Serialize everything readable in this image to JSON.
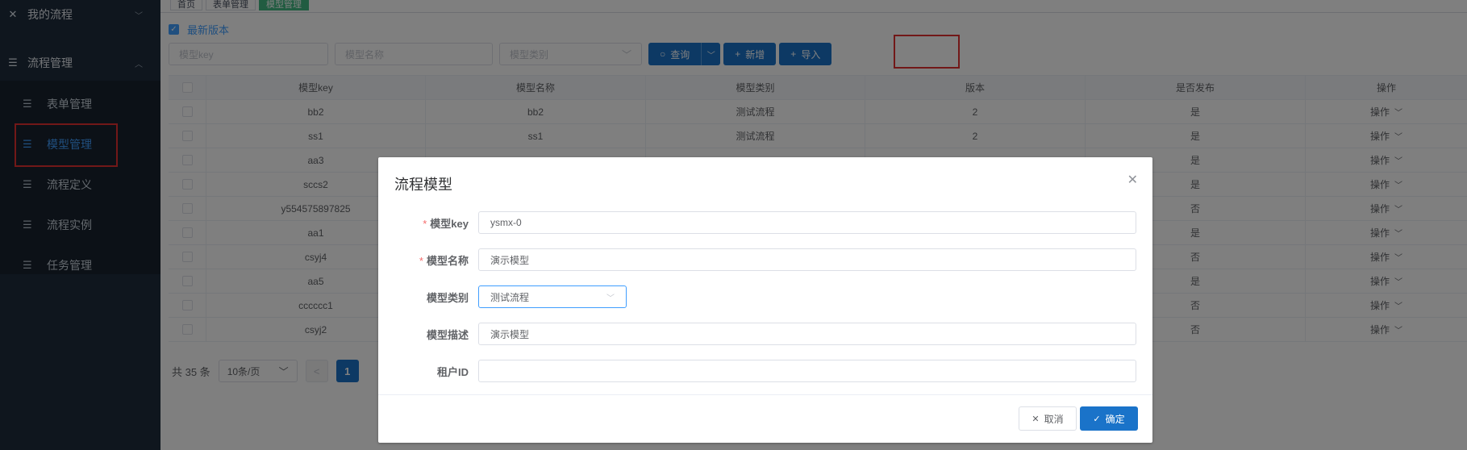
{
  "sidebar": {
    "top_item": {
      "label": "我的流程",
      "icon": "tools-icon"
    },
    "group": {
      "label": "流程管理",
      "icon": "list-icon"
    },
    "items": [
      {
        "label": "表单管理",
        "icon": "list-icon"
      },
      {
        "label": "模型管理",
        "icon": "list-icon",
        "active": true
      },
      {
        "label": "流程定义",
        "icon": "list-icon"
      },
      {
        "label": "流程实例",
        "icon": "list-icon"
      },
      {
        "label": "任务管理",
        "icon": "list-icon"
      }
    ]
  },
  "tabs": [
    "首页",
    "表单管理",
    "模型管理"
  ],
  "filter": {
    "latest_label": "最新版本",
    "key_placeholder": "模型key",
    "name_placeholder": "模型名称",
    "category_placeholder": "模型类别",
    "query_label": "查询",
    "add_label": "新增",
    "import_label": "导入"
  },
  "table": {
    "headers": [
      "",
      "模型key",
      "模型名称",
      "模型类别",
      "版本",
      "是否发布",
      "操作"
    ],
    "rows": [
      {
        "key": "bb2",
        "name": "bb2",
        "category": "测试流程",
        "version": "2",
        "published": "是",
        "op": "操作"
      },
      {
        "key": "ss1",
        "name": "ss1",
        "category": "测试流程",
        "version": "2",
        "published": "是",
        "op": "操作"
      },
      {
        "key": "aa3",
        "name": "",
        "category": "",
        "version": "",
        "published": "是",
        "op": "操作"
      },
      {
        "key": "sccs2",
        "name": "",
        "category": "",
        "version": "",
        "published": "是",
        "op": "操作"
      },
      {
        "key": "y554575897825",
        "name": "",
        "category": "",
        "version": "",
        "published": "否",
        "op": "操作"
      },
      {
        "key": "aa1",
        "name": "",
        "category": "",
        "version": "",
        "published": "是",
        "op": "操作"
      },
      {
        "key": "csyj4",
        "name": "",
        "category": "",
        "version": "",
        "published": "否",
        "op": "操作"
      },
      {
        "key": "aa5",
        "name": "",
        "category": "",
        "version": "",
        "published": "是",
        "op": "操作"
      },
      {
        "key": "cccccc1",
        "name": "",
        "category": "",
        "version": "",
        "published": "否",
        "op": "操作"
      },
      {
        "key": "csyj2",
        "name": "",
        "category": "",
        "version": "",
        "published": "否",
        "op": "操作"
      }
    ]
  },
  "pager": {
    "total": "共 35 条",
    "page_size": "10条/页",
    "prev": "<",
    "current": "1"
  },
  "dialog": {
    "title": "流程模型",
    "fields": [
      {
        "label": "模型key",
        "required": true,
        "value": "ysmx-0"
      },
      {
        "label": "模型名称",
        "required": true,
        "value": "演示模型"
      },
      {
        "label": "模型类别",
        "required": false,
        "value": "测试流程"
      },
      {
        "label": "模型描述",
        "required": false,
        "value": "演示模型"
      },
      {
        "label": "租户ID",
        "required": false,
        "value": ""
      }
    ],
    "cancel_label": "取消",
    "ok_label": "确定"
  },
  "colors": {
    "primary": "#1a73c9",
    "sidebar_bg": "#1f2d3d",
    "highlight": "#e53030",
    "active_tab": "#42b983"
  }
}
